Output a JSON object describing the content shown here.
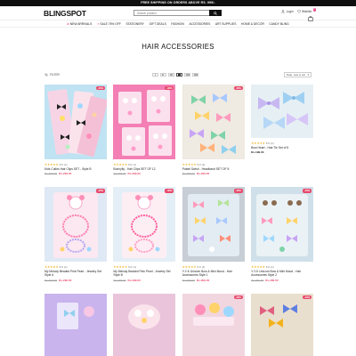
{
  "announcement": "FREE SHIPPING ON ORDERS ABOVE RS. 999/-",
  "brand": {
    "logo": "BLINGSPOT",
    "accent": "#e8458b",
    "sale_color": "#e84a6b"
  },
  "header": {
    "search_placeholder": "Search product",
    "login": "Login",
    "wishlist": "Wishlist",
    "cart_count": "0"
  },
  "nav": [
    {
      "label": "NEW ARRIVALS",
      "marker": "✿"
    },
    {
      "label": "SALE 75% OFF",
      "marker": "✦"
    },
    {
      "label": "STATIONERY",
      "marker": ""
    },
    {
      "label": "GIFT DEALS",
      "marker": ""
    },
    {
      "label": "FASHION",
      "marker": ""
    },
    {
      "label": "ACCESSORIES",
      "marker": ""
    },
    {
      "label": "ART SUPPLIES",
      "marker": ""
    },
    {
      "label": "HOME & DECOR",
      "marker": ""
    },
    {
      "label": "CANDY BLING",
      "marker": ""
    }
  ],
  "page_title": "HAIR ACCESSORIES",
  "toolbar": {
    "filter": "FILTER",
    "sort": "Date, new to old"
  },
  "products": [
    {
      "badge": "-40%",
      "rating": "5.0",
      "reviews": "(1)",
      "name": "Kids Cuties Hair Clips SET - Style B",
      "old_price": "Rs.499.00",
      "price": "Rs.299.00",
      "bg": "#bfe3f2"
    },
    {
      "badge": "-40%",
      "rating": "5.0",
      "reviews": "(1)",
      "name": "Bunnyfly - Hair Clips SET OF 12",
      "old_price": "Rs.499.00",
      "price": "Rs.299.00",
      "bg": "#f37fb4"
    },
    {
      "badge": "-40%",
      "rating": "5.0",
      "reviews": "(1)",
      "name": "Pastel Swish - Headband SET OF 8",
      "old_price": "Rs.499.00",
      "price": "Rs.299.00",
      "bg": "#efeae2"
    },
    {
      "badge": "",
      "rating": "5.0",
      "reviews": "(1)",
      "name": "Bow Heart - Hair Tie Set of 5",
      "old_price": "",
      "price": "Rs.199.00",
      "bg": "#e6f0f4"
    },
    {
      "badge": "-40%",
      "rating": "5.0",
      "reviews": "(1)",
      "name": "My Melody Beaded Pink Pearl - Jewelry Set Style A",
      "old_price": "Rs.499.00",
      "price": "Rs.299.00",
      "bg": "#dfe9f5"
    },
    {
      "badge": "-40%",
      "rating": "5.0",
      "reviews": "(1)",
      "name": "My Melody Beaded Pink Pearl - Jewelry Set Style B",
      "old_price": "Rs.499.00",
      "price": "Rs.299.00",
      "bg": "#e4eef6"
    },
    {
      "badge": "-40%",
      "rating": "5.0",
      "reviews": "(1)",
      "name": "Y-Y-K Unicorn Bow & Mini Mood - Hair Accessories Style 1",
      "old_price": "Rs.499.00",
      "price": "Rs.299.00",
      "bg": "#c7ced6"
    },
    {
      "badge": "-40%",
      "rating": "5.0",
      "reviews": "(1)",
      "name": "Y-Y-K Unicorn Bow & Mini Mood - Hair Accessories Style 2",
      "old_price": "Rs.499.00",
      "price": "Rs.299.00",
      "bg": "#cfe0ea"
    },
    {
      "badge": "",
      "rating": "",
      "reviews": "",
      "name": "",
      "old_price": "",
      "price": "",
      "bg": "#c9b4ee"
    },
    {
      "badge": "",
      "rating": "",
      "reviews": "",
      "name": "",
      "old_price": "",
      "price": "",
      "bg": "#e9c4da"
    },
    {
      "badge": "-40%",
      "rating": "",
      "reviews": "",
      "name": "",
      "old_price": "",
      "price": "",
      "bg": "#f1d6e0"
    },
    {
      "badge": "-40%",
      "rating": "",
      "reviews": "",
      "name": "",
      "old_price": "",
      "price": "",
      "bg": "#e9dfcf"
    }
  ]
}
